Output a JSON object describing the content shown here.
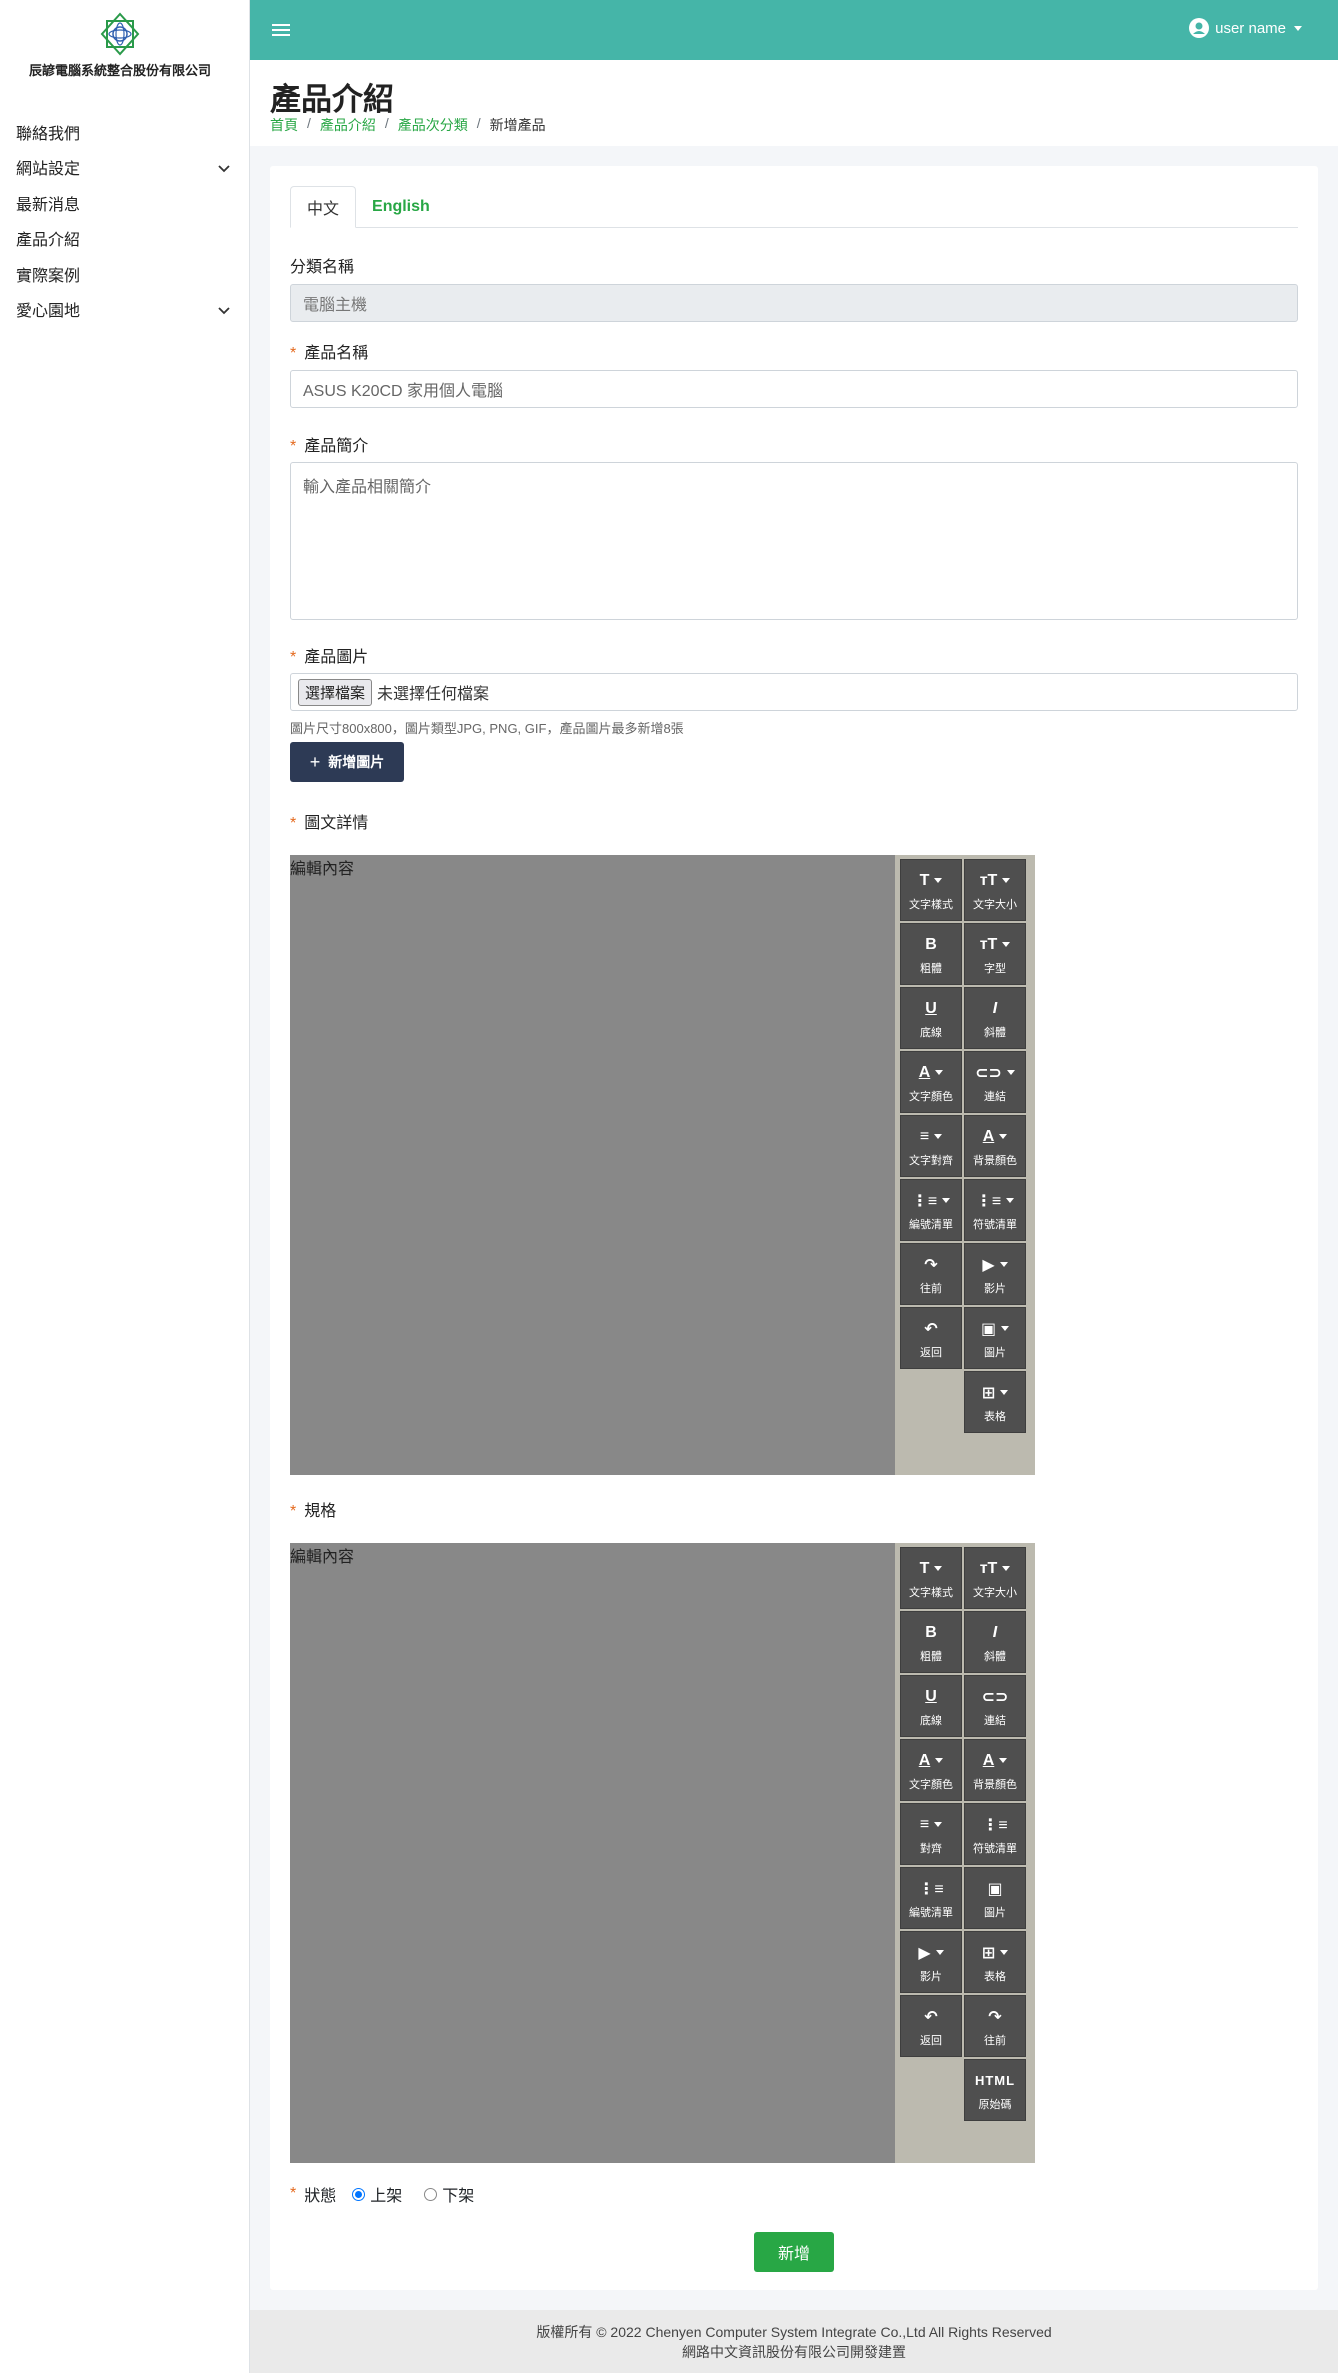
{
  "sidebar": {
    "logo_text": "辰諺電腦系統整合股份有限公司",
    "items": [
      {
        "label": "聯絡我們",
        "has_children": false
      },
      {
        "label": "網站設定",
        "has_children": true
      },
      {
        "label": "最新消息",
        "has_children": false
      },
      {
        "label": "產品介紹",
        "has_children": false
      },
      {
        "label": "實際案例",
        "has_children": false
      },
      {
        "label": "愛心園地",
        "has_children": true
      }
    ]
  },
  "topbar": {
    "user_name": "user name",
    "accent": "#45b5a8"
  },
  "header": {
    "title": "產品介紹",
    "breadcrumb": [
      "首頁",
      "產品介紹",
      "產品次分類",
      "新增產品"
    ]
  },
  "form": {
    "tabs": [
      "中文",
      "English"
    ],
    "category_label": "分類名稱",
    "category_value": "電腦主機",
    "name_label": "產品名稱",
    "name_value": "ASUS K20CD 家用個人電腦",
    "intro_label": "產品簡介",
    "intro_placeholder": "輸入產品相關簡介",
    "image_label": "產品圖片",
    "file_button": "選擇檔案",
    "file_status": "未選擇任何檔案",
    "image_hint": "圖片尺寸800x800，圖片類型JPG, PNG, GIF，產品圖片最多新增8張",
    "add_image_button": "新增圖片",
    "detail_label": "圖文詳情",
    "spec_label": "規格",
    "editor_placeholder": "編輯內容",
    "status_label": "狀態",
    "status_on": "上架",
    "status_off": "下架",
    "status_selected": "上架",
    "submit_label": "新增"
  },
  "editor1_buttons": [
    {
      "label": "文字樣式",
      "icon": "T",
      "dropdown": true
    },
    {
      "label": "文字大小",
      "icon": "тT",
      "dropdown": true
    },
    {
      "label": "粗體",
      "icon": "B",
      "dropdown": false
    },
    {
      "label": "字型",
      "icon": "тT",
      "dropdown": true
    },
    {
      "label": "底線",
      "icon": "U",
      "dropdown": false
    },
    {
      "label": "斜體",
      "icon": "I",
      "dropdown": false
    },
    {
      "label": "文字顏色",
      "icon": "A",
      "dropdown": true
    },
    {
      "label": "連結",
      "icon": "⊂⊃",
      "dropdown": true
    },
    {
      "label": "文字對齊",
      "icon": "≡",
      "dropdown": true
    },
    {
      "label": "背景顏色",
      "icon": "A",
      "dropdown": true
    },
    {
      "label": "編號清單",
      "icon": "⋮≡",
      "dropdown": true
    },
    {
      "label": "符號清單",
      "icon": "⋮≡",
      "dropdown": true
    },
    {
      "label": "往前",
      "icon": "↷",
      "dropdown": false
    },
    {
      "label": "影片",
      "icon": "▶",
      "dropdown": true
    },
    {
      "label": "返回",
      "icon": "↶",
      "dropdown": false
    },
    {
      "label": "圖片",
      "icon": "▣",
      "dropdown": true
    },
    {
      "label": "表格",
      "icon": "⊞",
      "dropdown": true
    }
  ],
  "editor2_buttons": [
    {
      "label": "文字樣式",
      "icon": "T",
      "dropdown": true
    },
    {
      "label": "文字大小",
      "icon": "тT",
      "dropdown": true
    },
    {
      "label": "粗體",
      "icon": "B",
      "dropdown": false
    },
    {
      "label": "斜體",
      "icon": "I",
      "dropdown": false
    },
    {
      "label": "底線",
      "icon": "U",
      "dropdown": false
    },
    {
      "label": "連結",
      "icon": "⊂⊃",
      "dropdown": false
    },
    {
      "label": "文字顏色",
      "icon": "A",
      "dropdown": true
    },
    {
      "label": "背景顏色",
      "icon": "A",
      "dropdown": true
    },
    {
      "label": "對齊",
      "icon": "≡",
      "dropdown": true
    },
    {
      "label": "符號清單",
      "icon": "⋮≡",
      "dropdown": false
    },
    {
      "label": "編號清單",
      "icon": "⋮≡",
      "dropdown": false
    },
    {
      "label": "圖片",
      "icon": "▣",
      "dropdown": false
    },
    {
      "label": "影片",
      "icon": "▶",
      "dropdown": true
    },
    {
      "label": "表格",
      "icon": "⊞",
      "dropdown": true
    },
    {
      "label": "返回",
      "icon": "↶",
      "dropdown": false
    },
    {
      "label": "往前",
      "icon": "↷",
      "dropdown": false
    },
    {
      "label": "原始碼",
      "icon": "HTML",
      "dropdown": false
    }
  ],
  "footer": {
    "line1": "版權所有 © 2022 Chenyen Computer System Integrate Co.,Ltd All Rights Reserved",
    "line2": "網路中文資訊股份有限公司開發建置"
  }
}
